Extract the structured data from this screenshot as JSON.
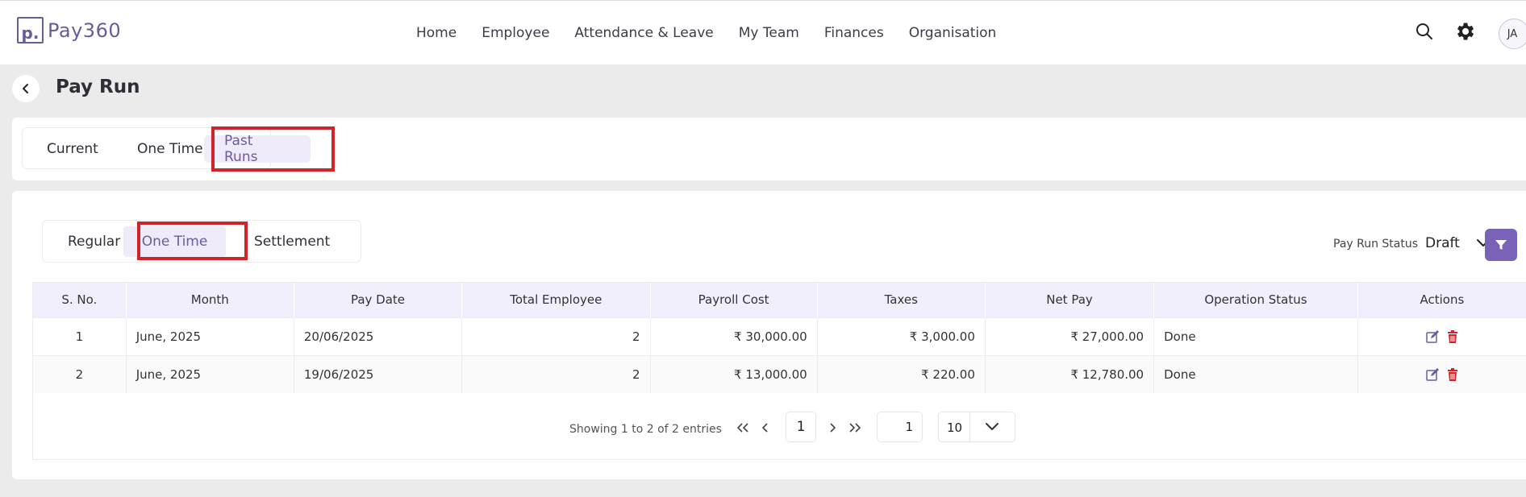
{
  "app": {
    "logo_letter": "p.",
    "logo_text": "Pay360"
  },
  "nav": {
    "items": [
      "Home",
      "Employee",
      "Attendance & Leave",
      "My Team",
      "Finances",
      "Organisation"
    ]
  },
  "user": {
    "initials": "JA"
  },
  "page": {
    "title": "Pay Run"
  },
  "run_tabs": {
    "items": [
      "Current",
      "One Time",
      "Past Runs"
    ],
    "active": "Past Runs"
  },
  "type_tabs": {
    "items": [
      "Regular",
      "One Time",
      "Settlement"
    ],
    "active": "One Time"
  },
  "filter": {
    "label": "Pay Run Status",
    "value": "Draft"
  },
  "table": {
    "columns": [
      "S. No.",
      "Month",
      "Pay Date",
      "Total Employee",
      "Payroll Cost",
      "Taxes",
      "Net Pay",
      "Operation Status",
      "Actions"
    ],
    "rows": [
      {
        "sno": "1",
        "month": "June, 2025",
        "pay_date": "20/06/2025",
        "total_employee": "2",
        "payroll_cost": "₹ 30,000.00",
        "taxes": "₹ 3,000.00",
        "net_pay": "₹ 27,000.00",
        "status": "Done"
      },
      {
        "sno": "2",
        "month": "June, 2025",
        "pay_date": "19/06/2025",
        "total_employee": "2",
        "payroll_cost": "₹ 13,000.00",
        "taxes": "₹ 220.00",
        "net_pay": "₹ 12,780.00",
        "status": "Done"
      }
    ]
  },
  "pagination": {
    "info": "Showing 1 to 2 of 2 entries",
    "current_page": "1",
    "goto_page": "1",
    "page_size": "10"
  },
  "colors": {
    "accent": "#7a63b6",
    "highlight": "#d0232a",
    "delete": "#d0232a"
  }
}
